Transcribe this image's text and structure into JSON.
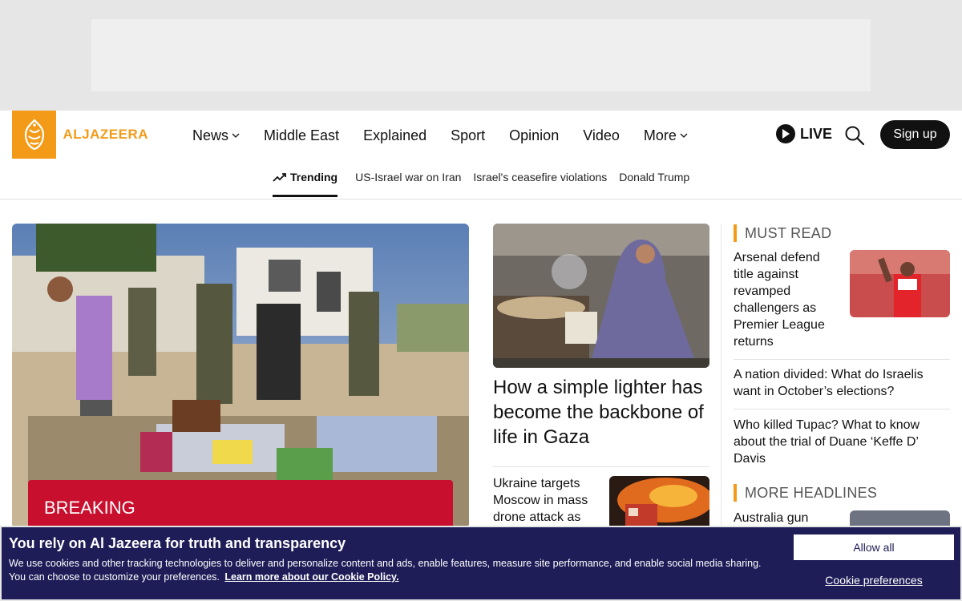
{
  "brand": {
    "name": "ALJAZEERA",
    "color": "#f39b18"
  },
  "nav": {
    "items": [
      {
        "label": "News",
        "has_dropdown": true
      },
      {
        "label": "Middle East",
        "has_dropdown": false
      },
      {
        "label": "Explained",
        "has_dropdown": false
      },
      {
        "label": "Sport",
        "has_dropdown": false
      },
      {
        "label": "Opinion",
        "has_dropdown": false
      },
      {
        "label": "Video",
        "has_dropdown": false
      },
      {
        "label": "More",
        "has_dropdown": true
      }
    ],
    "live_label": "LIVE",
    "signup_label": "Sign up",
    "icons": {
      "live": "play-icon",
      "search": "search-icon"
    }
  },
  "trending": {
    "label": "Trending",
    "links": [
      "US-Israel war on Iran",
      "Israel's ceasefire violations",
      "Donald Trump"
    ]
  },
  "lead": {
    "badge": "BREAKING",
    "badge_color": "#c8102e"
  },
  "middle": {
    "main_headline": "How a simple lighter has become the backbone of life in Gaza",
    "second_headline": "Ukraine targets Moscow in mass drone attack as"
  },
  "rail": {
    "must_read_title": "MUST READ",
    "must_read_main": "Arsenal defend title against revamped challengers as Premier League returns",
    "must_read_items": [
      "A nation divided: What do Israelis want in October’s elections?",
      "Who killed Tupac? What to know about the trial of Duane ‘Keffe D’ Davis"
    ],
    "more_headlines_title": "MORE HEADLINES",
    "more_headlines_first": "Australia gun"
  },
  "cookie": {
    "title": "You rely on Al Jazeera for truth and transparency",
    "text": "We use cookies and other tracking technologies to deliver and personalize content and ads, enable features, measure site performance, and enable social media sharing. You can choose to customize your preferences.",
    "policy_link": "Learn more about our Cookie Policy.",
    "allow_all": "Allow all",
    "preferences": "Cookie preferences",
    "background": "#1e1d58"
  }
}
